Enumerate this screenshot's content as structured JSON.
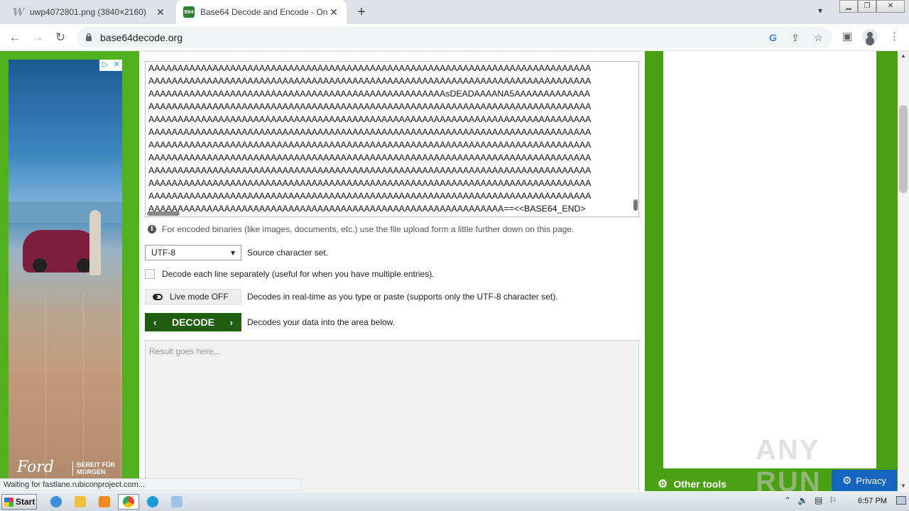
{
  "browser": {
    "tabs": [
      {
        "title": "uwp4072801.png (3840×2160)",
        "icon": "wikimedia-w-icon",
        "active": false
      },
      {
        "title": "Base64 Decode and Encode - Online",
        "icon": "b64-favicon",
        "active": true
      }
    ],
    "address": "base64decode.org",
    "new_tab_symbol": "+",
    "status_text": "Waiting for fastlane.rubiconproject.com..."
  },
  "ad": {
    "brand": "Ford",
    "slogan": "BEREIT FÜR MORGEN",
    "badge_play": "▷",
    "badge_close": "✕"
  },
  "main": {
    "encoded_lines": [
      "AAAAAAAAAAAAAAAAAAAAAAAAAAAAAAAAAAAAAAAAAAAAAAAAAAAAAAAAAAAAAAAAAAAAAAAAAAAA",
      "AAAAAAAAAAAAAAAAAAAAAAAAAAAAAAAAAAAAAAAAAAAAAAAAAAAAAAAAAAAAAAAAAAAAAAAAAAAA",
      "AAAAAAAAAAAAAAAAAAAAAAAAAAAAAAAAAAAAAAAAAAAAAAAAAAAsDEADAAAANA5AAAAAAAAAAAAA",
      "AAAAAAAAAAAAAAAAAAAAAAAAAAAAAAAAAAAAAAAAAAAAAAAAAAAAAAAAAAAAAAAAAAAAAAAAAAAA",
      "AAAAAAAAAAAAAAAAAAAAAAAAAAAAAAAAAAAAAAAAAAAAAAAAAAAAAAAAAAAAAAAAAAAAAAAAAAAA",
      "AAAAAAAAAAAAAAAAAAAAAAAAAAAAAAAAAAAAAAAAAAAAAAAAAAAAAAAAAAAAAAAAAAAAAAAAAAAA",
      "AAAAAAAAAAAAAAAAAAAAAAAAAAAAAAAAAAAAAAAAAAAAAAAAAAAAAAAAAAAAAAAAAAAAAAAAAAAA",
      "AAAAAAAAAAAAAAAAAAAAAAAAAAAAAAAAAAAAAAAAAAAAAAAAAAAAAAAAAAAAAAAAAAAAAAAAAAAA",
      "AAAAAAAAAAAAAAAAAAAAAAAAAAAAAAAAAAAAAAAAAAAAAAAAAAAAAAAAAAAAAAAAAAAAAAAAAAAA",
      "AAAAAAAAAAAAAAAAAAAAAAAAAAAAAAAAAAAAAAAAAAAAAAAAAAAAAAAAAAAAAAAAAAAAAAAAAAAA",
      "AAAAAAAAAAAAAAAAAAAAAAAAAAAAAAAAAAAAAAAAAAAAAAAAAAAAAAAAAAAAAAAAAAAAAAAAAAAA",
      "AAAAAAAAAAAAAAAAAAAAAAAAAAAAAAAAAAAAAAAAAAAAAAAAAAAAAAAAAAAAA==<<BASE64_END>",
      ">"
    ],
    "info_text": "For encoded binaries (like images, documents, etc.) use the file upload form a little further down on this page.",
    "charset_value": "UTF-8",
    "charset_label": "Source character set.",
    "checkbox_label": "Decode each line separately (useful for when you have multiple entries).",
    "live_mode_label": "Live mode OFF",
    "live_mode_desc": "Decodes in real-time as you type or paste (supports only the UTF-8 character set).",
    "decode_label": "DECODE",
    "decode_desc": "Decodes your data into the area below.",
    "result_placeholder": "Result goes here..."
  },
  "sidebar": {
    "other_tools": "Other tools",
    "privacy": "Privacy",
    "watermark": "ANY RUN"
  },
  "taskbar": {
    "start": "Start",
    "clock": "6:57 PM"
  },
  "colors": {
    "page_green": "#52b01e",
    "decode_button": "#1e5e0e",
    "privacy_blue": "#1565c0"
  }
}
